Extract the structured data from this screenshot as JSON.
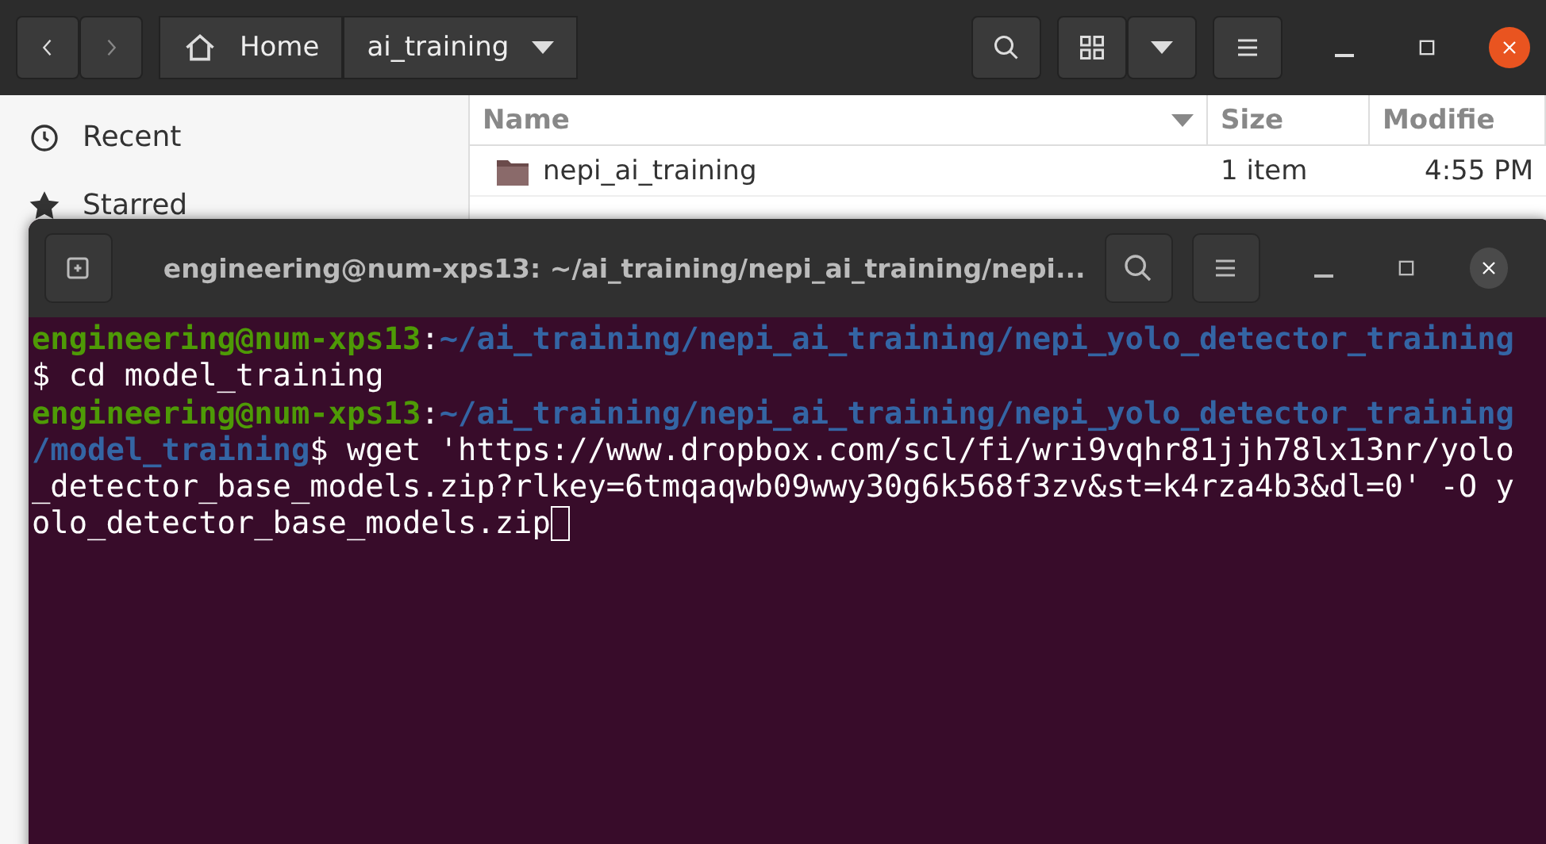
{
  "file_manager": {
    "path_bar": [
      {
        "label": "Home",
        "kind": "home"
      },
      {
        "label": "ai_training",
        "kind": "folder"
      }
    ],
    "sidebar": {
      "items": [
        {
          "label": "Recent",
          "kind": "recent"
        },
        {
          "label": "Starred",
          "kind": "starred"
        }
      ]
    },
    "table": {
      "columns": [
        "Name",
        "Size",
        "Modifie"
      ],
      "rows": [
        {
          "name": "nepi_ai_training",
          "size": "1 item",
          "modified": "4:55 PM"
        }
      ]
    }
  },
  "terminal": {
    "title": "engineering@num-xps13: ~/ai_training/nepi_ai_training/nepi...",
    "cursor_visible": true,
    "lines": [
      {
        "segments": [
          {
            "kind": "user",
            "text": "engineering@num-xps13"
          },
          {
            "kind": "plain",
            "text": ":"
          },
          {
            "kind": "path",
            "text": "~/ai_training/nepi_ai_training/nepi_yolo_detector_training"
          }
        ]
      },
      {
        "segments": [
          {
            "kind": "plain",
            "text": "$ cd model_training"
          }
        ]
      },
      {
        "segments": [
          {
            "kind": "user",
            "text": "engineering@num-xps13"
          },
          {
            "kind": "plain",
            "text": ":"
          },
          {
            "kind": "path",
            "text": "~/ai_training/nepi_ai_training/nepi_yolo_detector_training"
          }
        ]
      },
      {
        "segments": [
          {
            "kind": "path",
            "text": "/model_training"
          },
          {
            "kind": "plain",
            "text": "$ wget 'https://www.dropbox.com/scl/fi/wri9vqhr81jjh78lx13nr/yolo"
          }
        ]
      },
      {
        "segments": [
          {
            "kind": "plain",
            "text": "_detector_base_models.zip?rlkey=6tmqaqwb09wwy30g6k568f3zv&st=k4rza4b3&dl=0' -O y"
          }
        ]
      },
      {
        "segments": [
          {
            "kind": "plain",
            "text": "olo_detector_base_models.zip"
          }
        ]
      }
    ]
  }
}
